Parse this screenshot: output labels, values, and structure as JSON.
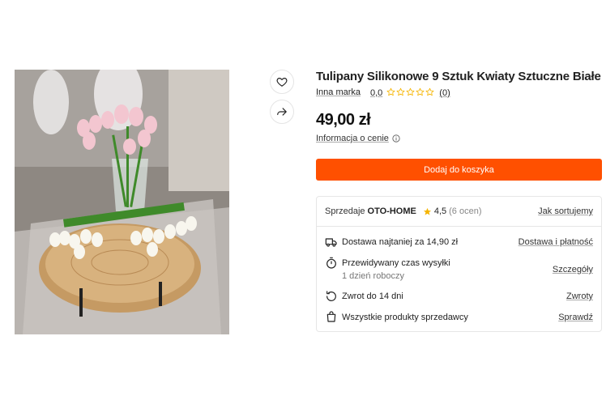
{
  "product": {
    "title": "Tulipany Silikonowe 9 Sztuk Kwiaty Sztuczne Białe",
    "brand": "Inna marka",
    "rating_value": "0,0",
    "rating_count": "(0)",
    "rating_stars": 0,
    "price": "49,00 zł",
    "price_info": "Informacja o cenie",
    "add_to_cart": "Dodaj do koszyka"
  },
  "seller": {
    "label": "Sprzedaje",
    "name": "OTO-HOME",
    "rating": "4,5",
    "ratings_count": "(6 ocen)",
    "sort_link": "Jak sortujemy"
  },
  "info_rows": [
    {
      "icon": "truck-icon",
      "text": "Dostawa najtaniej za 14,90 zł",
      "sub": "",
      "link": "Dostawa i płatność"
    },
    {
      "icon": "stopwatch-icon",
      "text": "Przewidywany czas wysyłki",
      "sub": "1 dzień roboczy",
      "link": "Szczegóły"
    },
    {
      "icon": "return-icon",
      "text": "Zwrot do 14 dni",
      "sub": "",
      "link": "Zwroty"
    },
    {
      "icon": "shopping-bag-icon",
      "text": "Wszystkie produkty sprzedawcy",
      "sub": "",
      "link": "Sprawdź"
    }
  ],
  "colors": {
    "accent": "#ff5000",
    "star": "#f5b400"
  }
}
